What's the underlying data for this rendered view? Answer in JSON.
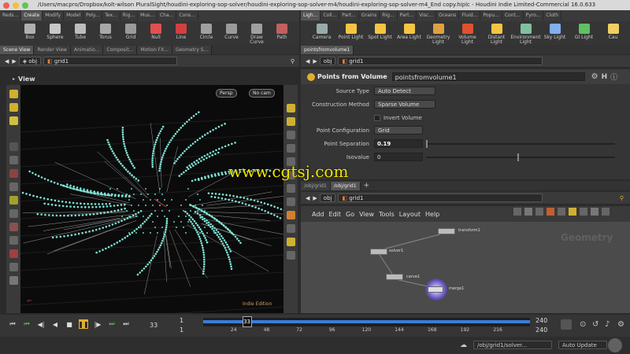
{
  "window": {
    "title": "/Users/macpro/Dropbox/kolt-wilson PluralSight/houdini-exploring-sop-solver/houdini-exploring-sop-solver-m4/houdini-exploring-sop-solver-m4_End copy.hiplc - Houdini Indie Limited-Commercial 16.0.633"
  },
  "left_shelf_tabs": [
    "Reds...",
    "Create",
    "Modify",
    "Model",
    "Poly...",
    "Tex...",
    "Rig...",
    "Mus...",
    "Cha...",
    "Cons..."
  ],
  "right_shelf_tabs": [
    "Ligh...",
    "Coll...",
    "Part...",
    "Grains",
    "Rig...",
    "Part...",
    "Visc...",
    "Oceans",
    "Fluid...",
    "Popu...",
    "Cont...",
    "Pyro...",
    "Cloth"
  ],
  "left_tools": [
    {
      "label": "Box",
      "icon": "box-icon",
      "color": "#b0b0b0"
    },
    {
      "label": "Sphere",
      "icon": "sphere-icon",
      "color": "#c8c8c8"
    },
    {
      "label": "Tube",
      "icon": "tube-icon",
      "color": "#bdbdbd"
    },
    {
      "label": "Torus",
      "icon": "torus-icon",
      "color": "#a8a8a8"
    },
    {
      "label": "Grid",
      "icon": "grid-icon",
      "color": "#9a9a9a"
    },
    {
      "label": "Null",
      "icon": "null-icon",
      "color": "#e05050"
    },
    {
      "label": "Line",
      "icon": "line-icon",
      "color": "#d04040"
    },
    {
      "label": "Circle",
      "icon": "circle-icon",
      "color": "#a0a0a0"
    },
    {
      "label": "Curve",
      "icon": "curve-icon",
      "color": "#9a9a9a"
    },
    {
      "label": "Draw Curve",
      "icon": "draw-curve-icon",
      "color": "#a0a0a0"
    },
    {
      "label": "Path",
      "icon": "path-icon",
      "color": "#c06060"
    }
  ],
  "right_tools": [
    {
      "label": "Camera",
      "icon": "camera-icon",
      "color": "#9aa"
    },
    {
      "label": "Point Light",
      "icon": "point-light-icon",
      "color": "#f5c542"
    },
    {
      "label": "Spot Light",
      "icon": "spot-light-icon",
      "color": "#f5c542"
    },
    {
      "label": "Area Light",
      "icon": "area-light-icon",
      "color": "#f5c542"
    },
    {
      "label": "Geometry Light",
      "icon": "geometry-light-icon",
      "color": "#e0a040"
    },
    {
      "label": "Volume Light",
      "icon": "volume-light-icon",
      "color": "#e05030"
    },
    {
      "label": "Distant Light",
      "icon": "distant-light-icon",
      "color": "#f5c542"
    },
    {
      "label": "Environment Light",
      "icon": "environment-light-icon",
      "color": "#80c0a0"
    },
    {
      "label": "Sky Light",
      "icon": "sky-light-icon",
      "color": "#80b0f0"
    },
    {
      "label": "GI Light",
      "icon": "gi-light-icon",
      "color": "#60c060"
    },
    {
      "label": "Cau",
      "icon": "caustic-light-icon",
      "color": "#f0d060"
    }
  ],
  "left_pane_tabs": [
    "Scene View",
    "Render View",
    "Animatio...",
    "Composit...",
    "Motion FX...",
    "Geometry S..."
  ],
  "path": {
    "context": "obj",
    "node": "grid1"
  },
  "viewport": {
    "label": "View",
    "persp": "Persp",
    "cam": "No cam",
    "edition": "Indie Edition"
  },
  "params": {
    "node_type": "Points from Volume",
    "node_name": "pointsfromvolume1",
    "rows": [
      {
        "label": "Source Type",
        "kind": "menu",
        "value": "Auto Detect"
      },
      {
        "label": "Construction Method",
        "kind": "menu",
        "value": "Sparse Volume"
      },
      {
        "label": "",
        "kind": "check",
        "value": "Invert Volume"
      },
      {
        "label": "Point Configuration",
        "kind": "menu",
        "value": "Grid"
      },
      {
        "label": "Point Separation",
        "kind": "slider",
        "value": "0.19"
      },
      {
        "label": "Isovalue",
        "kind": "slider",
        "value": "0"
      }
    ]
  },
  "right_tabs_top": [
    "pointsfromvolume1"
  ],
  "network_tabs": [
    "/obj/grid1",
    "/obj/grid1"
  ],
  "network_menu": [
    "Add",
    "Edit",
    "Go",
    "View",
    "Tools",
    "Layout",
    "Help"
  ],
  "network": {
    "context_label": "Geometry",
    "nodes": [
      {
        "name": "transform1"
      },
      {
        "name": "solver1"
      },
      {
        "name": "carve1"
      },
      {
        "name": "merge1"
      }
    ]
  },
  "watermark": "www.cgtsj.com",
  "timeline": {
    "current_frame": "33",
    "start": "1",
    "start2": "1",
    "end": "240",
    "end2": "240",
    "ticks": [
      "24",
      "48",
      "72",
      "96",
      "120",
      "144",
      "168",
      "192",
      "216"
    ]
  },
  "status": {
    "path": "/obj/grid1/solver...",
    "update": "Auto Update"
  }
}
